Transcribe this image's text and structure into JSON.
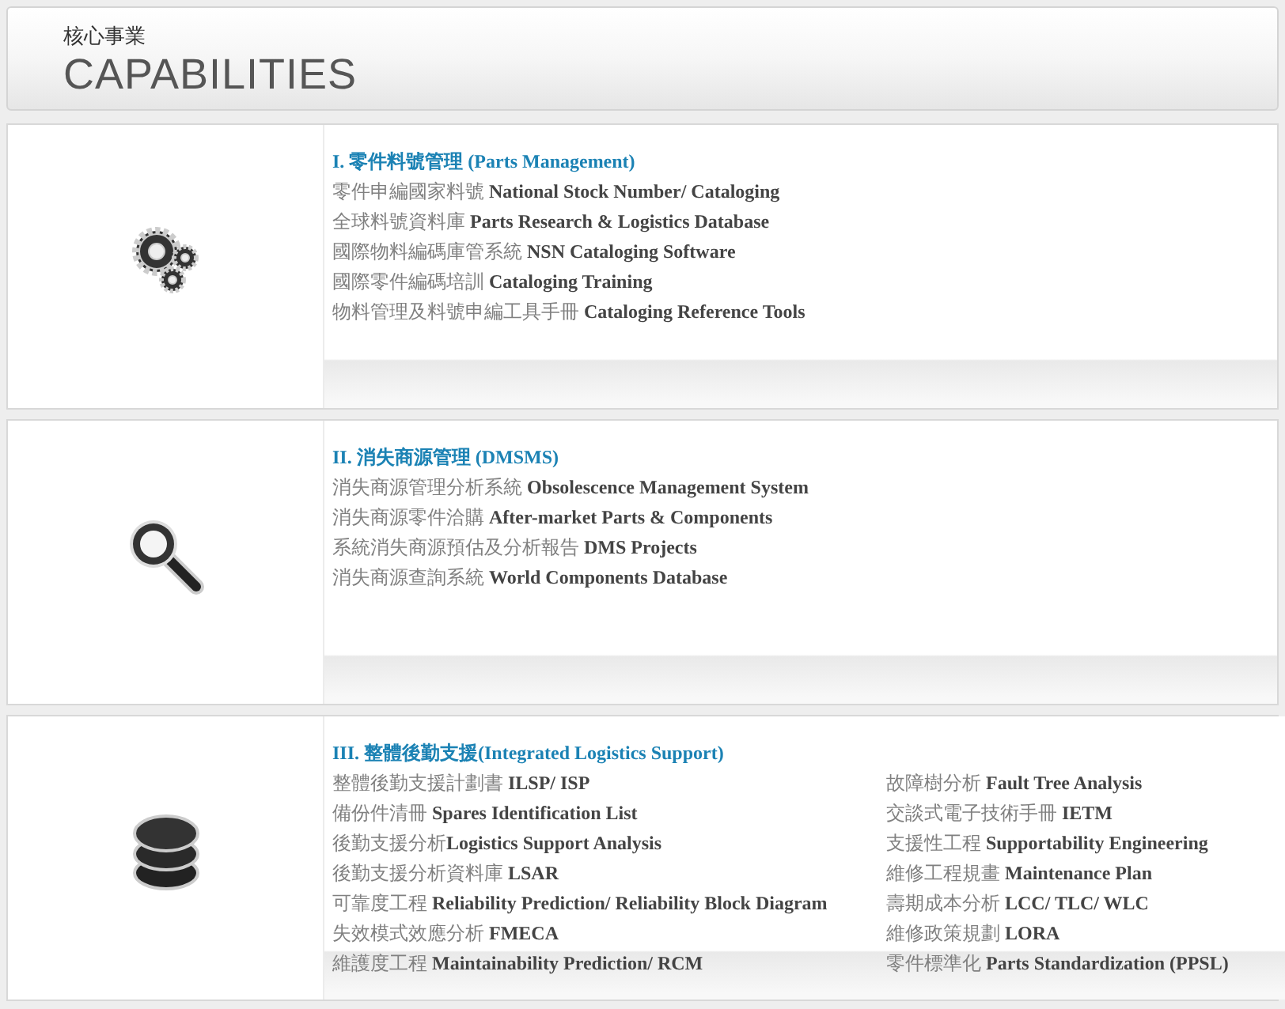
{
  "header": {
    "subtitle": "核心事業",
    "title": "CAPABILITIES"
  },
  "sections": [
    {
      "title": "I. 零件料號管理 (Parts Management)",
      "columns": [
        [
          "零件申編國家料號 **National Stock Number/ Cataloging**",
          "全球料號資料庫 **Parts Research & Logistics Database**",
          "國際物料編碼庫管系統 **NSN Cataloging Software**",
          "國際零件編碼培訓 **Cataloging Training**",
          "物料管理及料號申編工具手冊 **Cataloging Reference Tools**"
        ]
      ]
    },
    {
      "title": "II. 消失商源管理 (DMSMS)",
      "columns": [
        [
          "消失商源管理分析系統 **Obsolescence Management System**",
          "消失商源零件洽購 **After-market Parts & Components**",
          "系統消失商源預估及分析報告 **DMS Projects**",
          "消失商源查詢系統 **World Components Database**"
        ]
      ]
    },
    {
      "title": "III. 整體後勤支援(Integrated Logistics Support)",
      "columns": [
        [
          "整體後勤支援計劃書 **ILSP/ ISP**",
          "備份件清冊 **Spares Identification List**",
          "後勤支援分析**Logistics Support Analysis**",
          "後勤支援分析資料庫 **LSAR**",
          "可靠度工程 **Reliability Prediction/ Reliability Block Diagram**",
          "失效模式效應分析 **FMECA**",
          "維護度工程 **Maintainability Prediction/ RCM**"
        ],
        [
          "故障樹分析 **Fault Tree Analysis**",
          "交談式電子技術手冊 **IETM**",
          "支援性工程 **Supportability Engineering**",
          "維修工程規畫 **Maintenance Plan**",
          "壽期成本分析 **LCC/ TLC/ WLC**",
          "維修政策規劃 **LORA**",
          "零件標準化 **Parts Standardization (PPSL)**"
        ]
      ]
    }
  ]
}
